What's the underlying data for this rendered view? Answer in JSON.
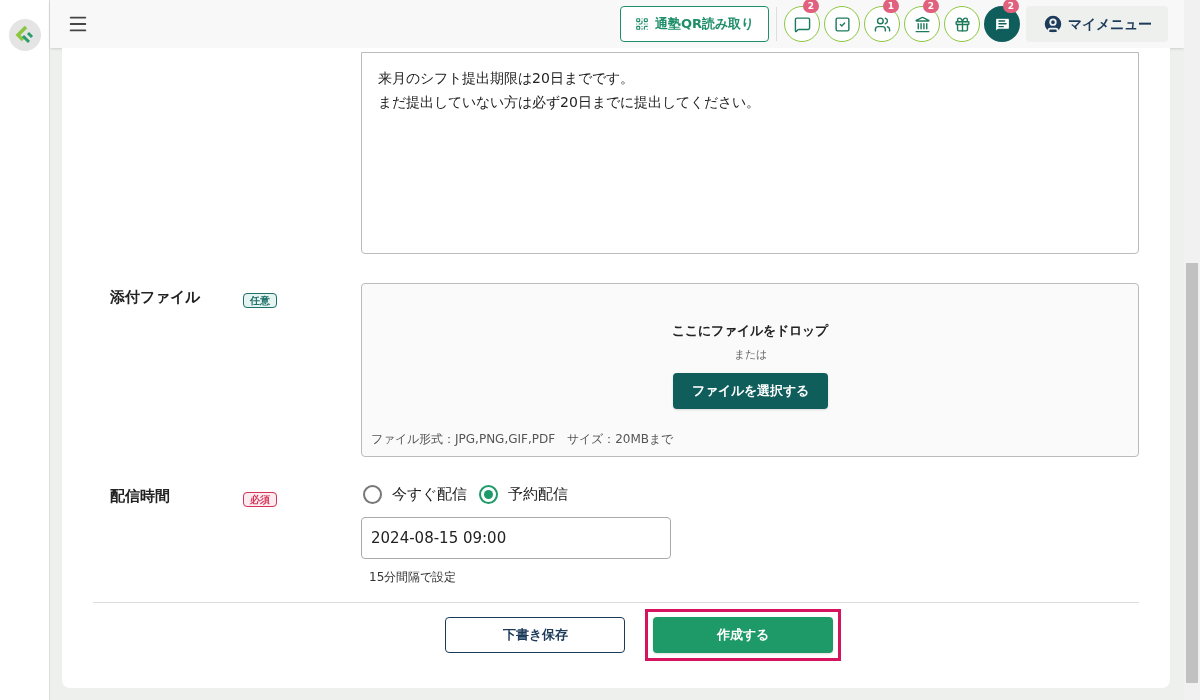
{
  "header": {
    "qr_button": "通塾QR読み取り",
    "icon_buttons": [
      {
        "kind": "chat",
        "badge": "2"
      },
      {
        "kind": "checklist"
      },
      {
        "kind": "users",
        "badge": "1"
      },
      {
        "kind": "school",
        "badge": "2"
      },
      {
        "kind": "gift"
      },
      {
        "kind": "messages",
        "badge": "2"
      }
    ],
    "my_menu": "マイメニュー"
  },
  "form": {
    "message_lines": [
      "来月のシフト提出期限は20日までです。",
      "まだ提出していない方は必ず20日までに提出してください。"
    ],
    "attachment": {
      "label": "添付ファイル",
      "tag": {
        "text": "任意",
        "kind": "optional"
      },
      "drop_text": "ここにファイルをドロップ",
      "or_text": "または",
      "select_button": "ファイルを選択する",
      "note": "ファイル形式：JPG,PNG,GIF,PDF　サイズ：20MBまで"
    },
    "delivery": {
      "label": "配信時間",
      "tag": {
        "text": "必須",
        "kind": "required"
      },
      "options": [
        {
          "label": "今すぐ配信",
          "selected": false
        },
        {
          "label": "予約配信",
          "selected": true
        }
      ],
      "datetime": "2024-08-15 09:00",
      "hint": "15分間隔で設定"
    }
  },
  "buttons": [
    {
      "label": "下書き保存",
      "kind": "secondary",
      "highlighted": false
    },
    {
      "label": "作成する",
      "kind": "primary",
      "highlighted": true
    }
  ]
}
